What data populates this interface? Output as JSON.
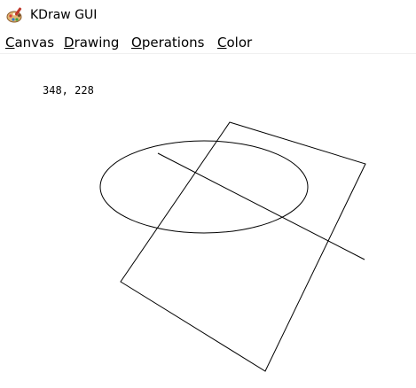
{
  "window": {
    "title": "KDraw GUI",
    "icon": "paint-palette-icon"
  },
  "menubar": {
    "items": [
      {
        "mnemonic": "C",
        "rest": "anvas"
      },
      {
        "mnemonic": "D",
        "rest": "rawing"
      },
      {
        "mnemonic": "O",
        "rest": "perations"
      },
      {
        "mnemonic": "C",
        "rest": "olor"
      }
    ]
  },
  "canvas": {
    "cursor_readout": "348, 228",
    "stroke_color": "#000000",
    "background_color": "#ffffff"
  }
}
